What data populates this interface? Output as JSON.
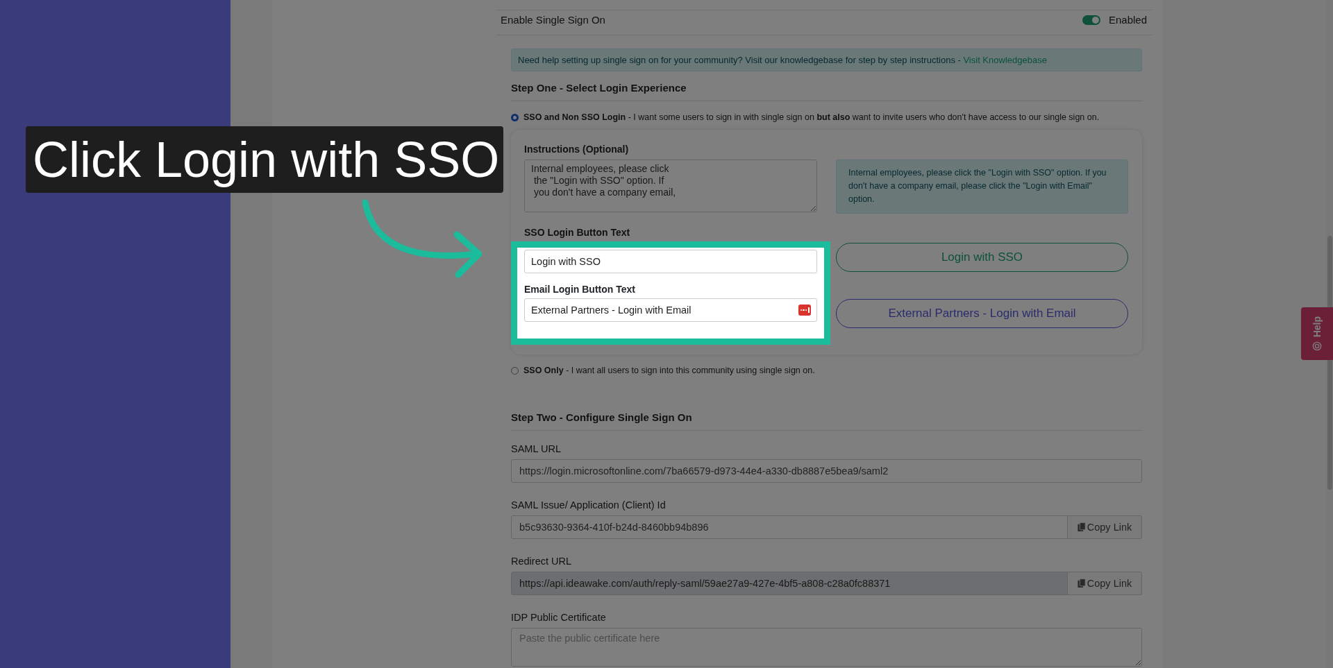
{
  "sso_setting": {
    "label": "Enable Single Sign On",
    "enabled": true,
    "status": "Enabled"
  },
  "help_alert": {
    "text": "Need help setting up single sign on for your community? Visit our knowledgebase for step by step instructions - ",
    "link": "Visit Knowledgebase"
  },
  "step_one": {
    "heading": "Step One - Select Login Experience",
    "options": [
      {
        "text": "**SSO and Non SSO Login** - I want some users to sign in with single sign on **but also** want to invite users who don't have access to our single sign on.",
        "selected": true
      },
      {
        "text": "**SSO Only** - I want all users to sign into this community using single sign on.",
        "selected": false
      }
    ],
    "instructions": {
      "label": "Instructions (Optional)",
      "value": "Internal employees, please click\n the \"Login with SSO\" option. If\n you don't have a company email,"
    },
    "sso_button_text": {
      "label": "SSO Login Button Text",
      "value": "Login with SSO"
    },
    "email_button_text": {
      "label": "Email Login Button Text",
      "value": "External Partners - Login with Email"
    },
    "preview": {
      "message": "Internal employees, please click the \"Login with SSO\" option. If you don't have a company email, please click the \"Login with Email\" option.",
      "buttons": [
        {
          "label": "Login with SSO",
          "kind": "sso"
        },
        {
          "label": "External Partners - Login with Email",
          "kind": "email"
        }
      ]
    }
  },
  "step_two": {
    "heading": "Step Two - Configure Single Sign On",
    "fields": [
      {
        "kind": "input",
        "label": "SAML URL",
        "value": "https://login.microsoftonline.com/7ba66579-d973-44e4-a330-db8887e5bea9/saml2",
        "readonly": false
      },
      {
        "kind": "copy",
        "label": "SAML Issue/ Application (Client) Id",
        "value": "b5c93630-9364-410f-b24d-8460bb94b896",
        "action": "Copy Link",
        "readonly": false
      },
      {
        "kind": "copy",
        "label": "Redirect URL",
        "value": "https://api.ideawake.com/auth/reply-saml/59ae27a9-427e-4bf5-a808-c28a0fc88371",
        "action": "Copy Link",
        "readonly": true
      },
      {
        "kind": "textarea",
        "label": "IDP Public Certificate",
        "placeholder": "Paste the public certificate here"
      }
    ]
  },
  "tutorial": {
    "caption": "Click Login with SSO"
  },
  "help_tab": {
    "label": "Help"
  }
}
